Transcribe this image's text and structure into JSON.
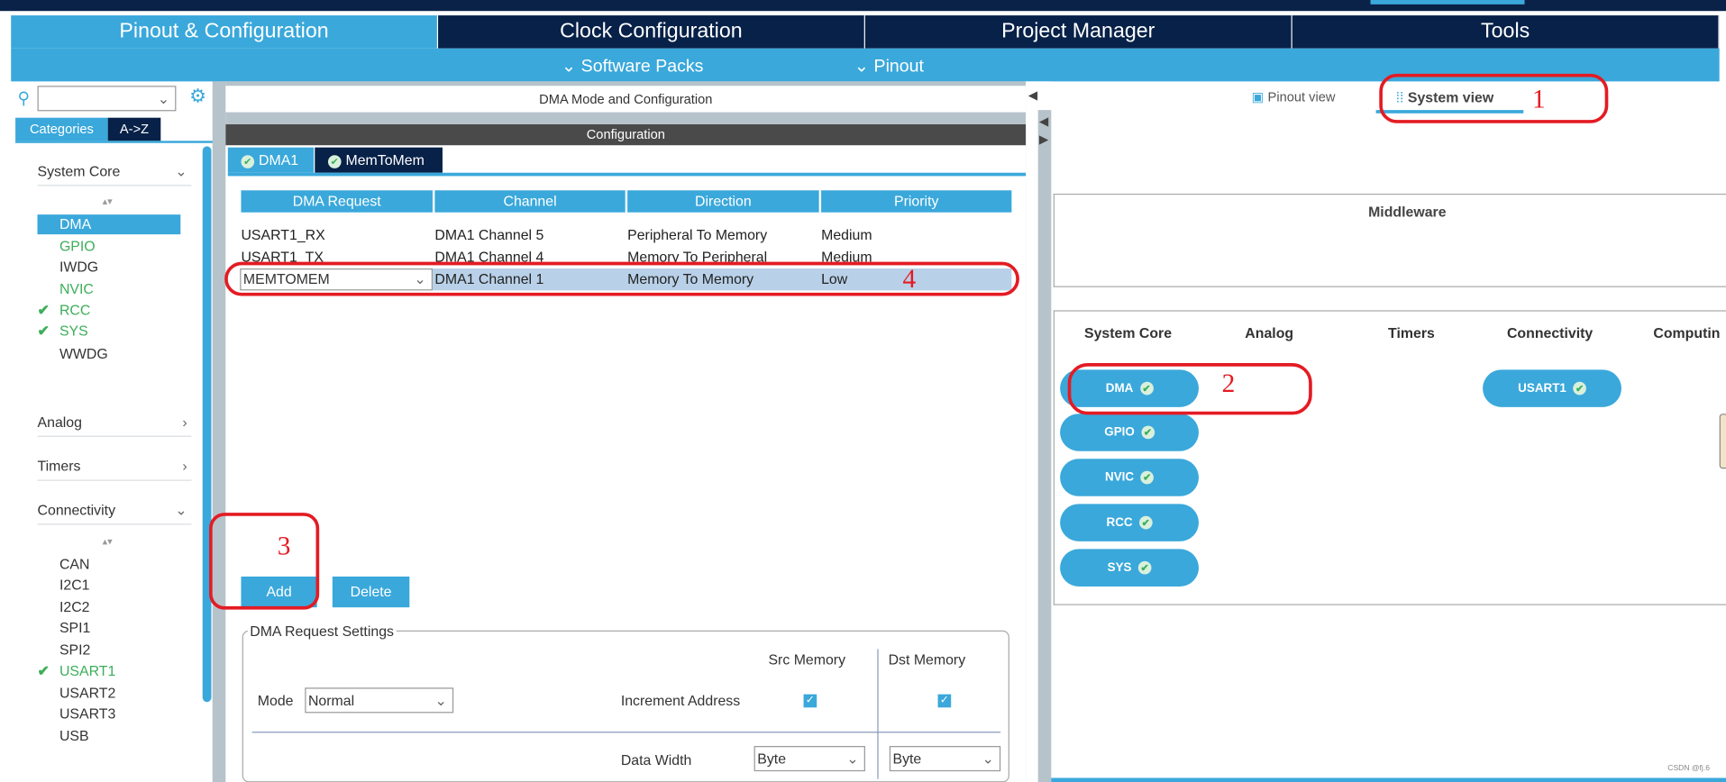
{
  "main_tabs": [
    {
      "label": "Pinout & Configuration",
      "active": true
    },
    {
      "label": "Clock Configuration"
    },
    {
      "label": "Project Manager"
    },
    {
      "label": "Tools"
    }
  ],
  "sub_menu": {
    "software_packs": "Software Packs",
    "pinout": "Pinout"
  },
  "left": {
    "search": {
      "value": "",
      "placeholder": ""
    },
    "tabs": [
      "Categories",
      "A->Z"
    ],
    "categories": [
      {
        "label": "System Core",
        "expanded": true,
        "items": [
          {
            "label": "DMA",
            "selected": true
          },
          {
            "label": "GPIO",
            "status": "configured"
          },
          {
            "label": "IWDG"
          },
          {
            "label": "NVIC",
            "status": "configured"
          },
          {
            "label": "RCC",
            "status": "checked"
          },
          {
            "label": "SYS",
            "status": "checked"
          },
          {
            "label": "WWDG"
          }
        ]
      },
      {
        "label": "Analog",
        "expanded": false
      },
      {
        "label": "Timers",
        "expanded": false
      },
      {
        "label": "Connectivity",
        "expanded": true,
        "items": [
          {
            "label": "CAN"
          },
          {
            "label": "I2C1"
          },
          {
            "label": "I2C2"
          },
          {
            "label": "SPI1"
          },
          {
            "label": "SPI2"
          },
          {
            "label": "USART1",
            "status": "checked"
          },
          {
            "label": "USART2"
          },
          {
            "label": "USART3"
          },
          {
            "label": "USB"
          }
        ]
      }
    ]
  },
  "middle": {
    "title": "DMA Mode and Configuration",
    "config_title": "Configuration",
    "tabs": [
      "DMA1",
      "MemToMem"
    ],
    "table": {
      "headers": [
        "DMA Request",
        "Channel",
        "Direction",
        "Priority"
      ],
      "rows": [
        [
          "USART1_RX",
          "DMA1 Channel 5",
          "Peripheral To Memory",
          "Medium"
        ],
        [
          "USART1_TX",
          "DMA1 Channel 4",
          "Memory To Peripheral",
          "Medium"
        ],
        [
          "MEMTOMEM",
          "DMA1 Channel 1",
          "Memory To Memory",
          "Low"
        ]
      ]
    },
    "add_label": "Add",
    "delete_label": "Delete",
    "settings": {
      "legend": "DMA Request Settings",
      "mode_label": "Mode",
      "mode_value": "Normal",
      "src_label": "Src Memory",
      "dst_label": "Dst Memory",
      "increment_label": "Increment Address",
      "src_increment": true,
      "dst_increment": true,
      "data_width_label": "Data Width",
      "src_width": "Byte",
      "dst_width": "Byte"
    }
  },
  "right": {
    "view_tabs": [
      {
        "label": "Pinout view"
      },
      {
        "label": "System view",
        "active": true
      }
    ],
    "middleware_title": "Middleware",
    "columns": [
      "System Core",
      "Analog",
      "Timers",
      "Connectivity",
      "Computin"
    ],
    "system_core_pills": [
      "DMA",
      "GPIO",
      "NVIC",
      "RCC",
      "SYS"
    ],
    "connectivity_pills": [
      "USART1"
    ]
  },
  "annotations": [
    "1",
    "2",
    "3",
    "4"
  ],
  "watermark": "CSDN @fj.6",
  "colors": {
    "accent": "#3aa8db",
    "dark": "#072148",
    "annotation": "#e41b23",
    "ok": "#3dae5a"
  }
}
